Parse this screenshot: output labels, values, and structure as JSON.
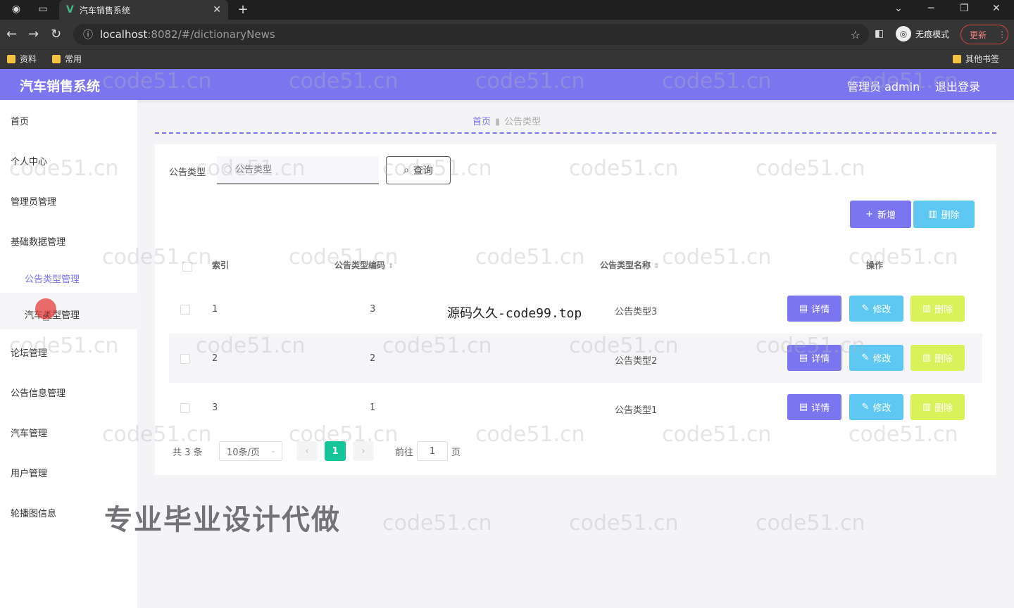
{
  "browser": {
    "tab_title": "汽车销售系统",
    "tab_logo": "V",
    "url_host": "localhost",
    "url_rest": ":8082/#/dictionaryNews",
    "incognito_label": "无痕模式",
    "update_label": "更新",
    "bookmarks": [
      "资料",
      "常用"
    ],
    "other_bookmarks": "其他书签"
  },
  "header": {
    "title": "汽车销售系统",
    "user": "管理员 admin",
    "logout": "退出登录"
  },
  "sidebar": {
    "items": [
      "首页",
      "个人中心",
      "管理员管理",
      "基础数据管理",
      "论坛管理",
      "公告信息管理",
      "汽车管理",
      "用户管理",
      "轮播图信息"
    ],
    "sub_items": [
      "公告类型管理",
      "汽车类型管理"
    ]
  },
  "breadcrumb": {
    "home": "首页",
    "current": "公告类型"
  },
  "search": {
    "label": "公告类型",
    "placeholder": "公告类型",
    "button": "查询"
  },
  "actions": {
    "add": "新增",
    "delete": "删除"
  },
  "table": {
    "headers": [
      "索引",
      "公告类型编码",
      "公告类型名称",
      "操作"
    ],
    "rows": [
      {
        "index": "1",
        "code": "3",
        "name": "公告类型3"
      },
      {
        "index": "2",
        "code": "2",
        "name": "公告类型2"
      },
      {
        "index": "3",
        "code": "1",
        "name": "公告类型1"
      }
    ],
    "row_actions": {
      "detail": "详情",
      "edit": "修改",
      "delete": "删除"
    }
  },
  "pagination": {
    "total": "共 3 条",
    "page_size": "10条/页",
    "current_page": "1",
    "goto_label": "前往",
    "goto_value": "1",
    "goto_suffix": "页"
  },
  "overlays": {
    "source_text": "源码久久-code99.top",
    "promo": "专业毕业设计代做",
    "watermark": "code51.cn"
  },
  "colors": {
    "primary": "#7c75f0",
    "info": "#5fc8f2",
    "warning": "#d9f25a",
    "page_active": "#16c49a"
  }
}
